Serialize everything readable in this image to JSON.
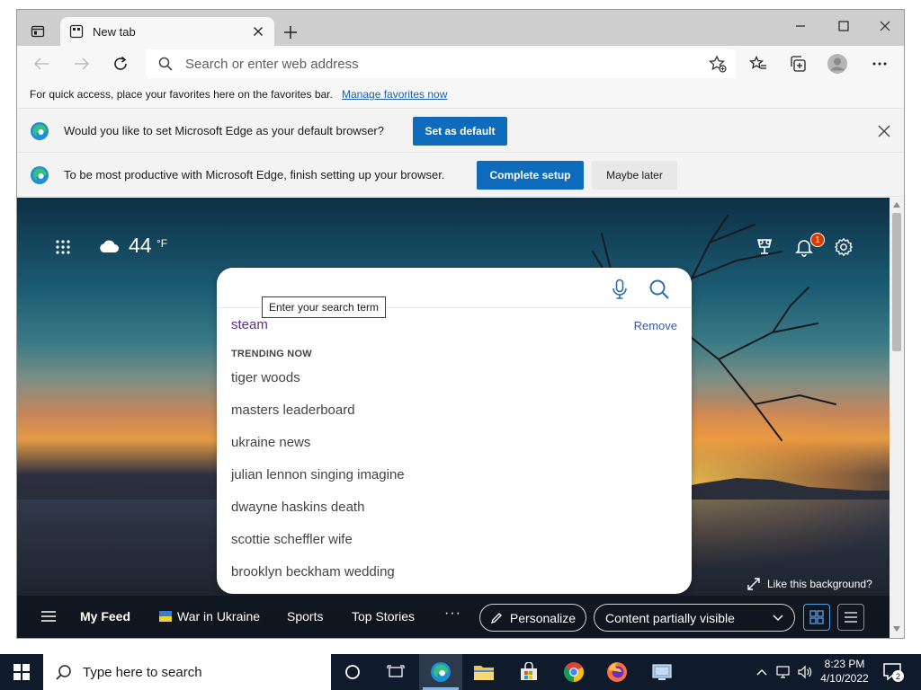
{
  "browser": {
    "tab_title": "New tab",
    "address_placeholder": "Search or enter web address",
    "favbar_text": "For quick access, place your favorites here on the favorites bar.",
    "favbar_link": "Manage favorites now"
  },
  "infobars": {
    "default": {
      "text": "Would you like to set Microsoft Edge as your default browser?",
      "button": "Set as default"
    },
    "setup": {
      "text": "To be most productive with Microsoft Edge, finish setting up your browser.",
      "primary": "Complete setup",
      "secondary": "Maybe later"
    }
  },
  "ntp": {
    "weather": {
      "temp": "44",
      "unit": "°F"
    },
    "notification_count": "1",
    "search": {
      "tooltip": "Enter your search term",
      "history_item": "steam",
      "remove_label": "Remove",
      "trending_heading": "TRENDING NOW",
      "suggestions": [
        "tiger woods",
        "masters leaderboard",
        "ukraine news",
        "julian lennon singing imagine",
        "dwayne haskins death",
        "scottie scheffler wife",
        "brooklyn beckham wedding"
      ]
    },
    "like_background": "Like this background?",
    "feed": {
      "my_feed": "My Feed",
      "war_in_ukraine": "War in Ukraine",
      "sports": "Sports",
      "top_stories": "Top Stories",
      "more": "···",
      "personalize": "Personalize",
      "content_visibility": "Content partially visible"
    }
  },
  "taskbar": {
    "search_placeholder": "Type here to search",
    "time": "8:23 PM",
    "date": "4/10/2022",
    "notification_count": "2"
  },
  "colors": {
    "accent": "#0f6cbd",
    "taskbar": "#0f1a2b",
    "history_link": "#5c2e91",
    "badge": "#d83b01"
  }
}
